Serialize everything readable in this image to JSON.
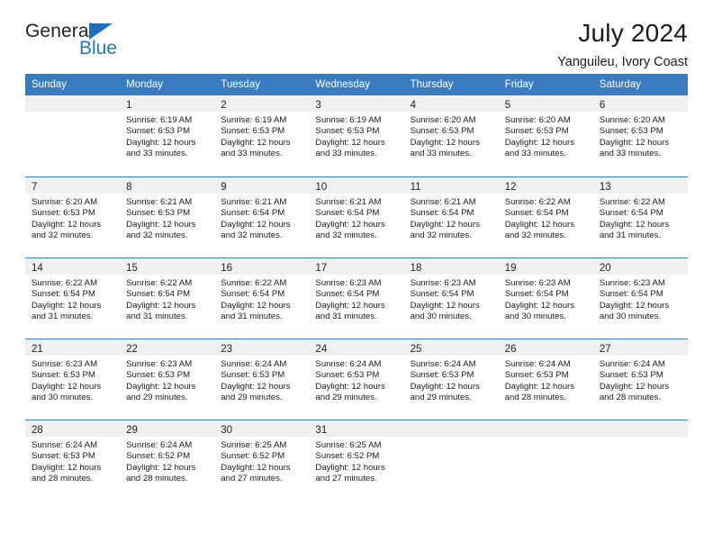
{
  "brand": {
    "name_top": "General",
    "name_bottom": "Blue",
    "triangle_color": "#1f6fc0",
    "blue_text_color": "#1f7ac4"
  },
  "header": {
    "title": "July 2024",
    "subtitle": "Yanguileu, Ivory Coast"
  },
  "theme": {
    "header_row_bg": "#3a7cc0",
    "daynum_band_bg": "#f0f0f0",
    "row_separator": "#3a7cc0"
  },
  "weekday_headers": [
    "Sunday",
    "Monday",
    "Tuesday",
    "Wednesday",
    "Thursday",
    "Friday",
    "Saturday"
  ],
  "weeks": [
    [
      {
        "day": "",
        "sunrise": "",
        "sunset": "",
        "daylight_line1": "",
        "daylight_line2": ""
      },
      {
        "day": "1",
        "sunrise": "Sunrise: 6:19 AM",
        "sunset": "Sunset: 6:53 PM",
        "daylight_line1": "Daylight: 12 hours",
        "daylight_line2": "and 33 minutes."
      },
      {
        "day": "2",
        "sunrise": "Sunrise: 6:19 AM",
        "sunset": "Sunset: 6:53 PM",
        "daylight_line1": "Daylight: 12 hours",
        "daylight_line2": "and 33 minutes."
      },
      {
        "day": "3",
        "sunrise": "Sunrise: 6:19 AM",
        "sunset": "Sunset: 6:53 PM",
        "daylight_line1": "Daylight: 12 hours",
        "daylight_line2": "and 33 minutes."
      },
      {
        "day": "4",
        "sunrise": "Sunrise: 6:20 AM",
        "sunset": "Sunset: 6:53 PM",
        "daylight_line1": "Daylight: 12 hours",
        "daylight_line2": "and 33 minutes."
      },
      {
        "day": "5",
        "sunrise": "Sunrise: 6:20 AM",
        "sunset": "Sunset: 6:53 PM",
        "daylight_line1": "Daylight: 12 hours",
        "daylight_line2": "and 33 minutes."
      },
      {
        "day": "6",
        "sunrise": "Sunrise: 6:20 AM",
        "sunset": "Sunset: 6:53 PM",
        "daylight_line1": "Daylight: 12 hours",
        "daylight_line2": "and 33 minutes."
      }
    ],
    [
      {
        "day": "7",
        "sunrise": "Sunrise: 6:20 AM",
        "sunset": "Sunset: 6:53 PM",
        "daylight_line1": "Daylight: 12 hours",
        "daylight_line2": "and 32 minutes."
      },
      {
        "day": "8",
        "sunrise": "Sunrise: 6:21 AM",
        "sunset": "Sunset: 6:53 PM",
        "daylight_line1": "Daylight: 12 hours",
        "daylight_line2": "and 32 minutes."
      },
      {
        "day": "9",
        "sunrise": "Sunrise: 6:21 AM",
        "sunset": "Sunset: 6:54 PM",
        "daylight_line1": "Daylight: 12 hours",
        "daylight_line2": "and 32 minutes."
      },
      {
        "day": "10",
        "sunrise": "Sunrise: 6:21 AM",
        "sunset": "Sunset: 6:54 PM",
        "daylight_line1": "Daylight: 12 hours",
        "daylight_line2": "and 32 minutes."
      },
      {
        "day": "11",
        "sunrise": "Sunrise: 6:21 AM",
        "sunset": "Sunset: 6:54 PM",
        "daylight_line1": "Daylight: 12 hours",
        "daylight_line2": "and 32 minutes."
      },
      {
        "day": "12",
        "sunrise": "Sunrise: 6:22 AM",
        "sunset": "Sunset: 6:54 PM",
        "daylight_line1": "Daylight: 12 hours",
        "daylight_line2": "and 32 minutes."
      },
      {
        "day": "13",
        "sunrise": "Sunrise: 6:22 AM",
        "sunset": "Sunset: 6:54 PM",
        "daylight_line1": "Daylight: 12 hours",
        "daylight_line2": "and 31 minutes."
      }
    ],
    [
      {
        "day": "14",
        "sunrise": "Sunrise: 6:22 AM",
        "sunset": "Sunset: 6:54 PM",
        "daylight_line1": "Daylight: 12 hours",
        "daylight_line2": "and 31 minutes."
      },
      {
        "day": "15",
        "sunrise": "Sunrise: 6:22 AM",
        "sunset": "Sunset: 6:54 PM",
        "daylight_line1": "Daylight: 12 hours",
        "daylight_line2": "and 31 minutes."
      },
      {
        "day": "16",
        "sunrise": "Sunrise: 6:22 AM",
        "sunset": "Sunset: 6:54 PM",
        "daylight_line1": "Daylight: 12 hours",
        "daylight_line2": "and 31 minutes."
      },
      {
        "day": "17",
        "sunrise": "Sunrise: 6:23 AM",
        "sunset": "Sunset: 6:54 PM",
        "daylight_line1": "Daylight: 12 hours",
        "daylight_line2": "and 31 minutes."
      },
      {
        "day": "18",
        "sunrise": "Sunrise: 6:23 AM",
        "sunset": "Sunset: 6:54 PM",
        "daylight_line1": "Daylight: 12 hours",
        "daylight_line2": "and 30 minutes."
      },
      {
        "day": "19",
        "sunrise": "Sunrise: 6:23 AM",
        "sunset": "Sunset: 6:54 PM",
        "daylight_line1": "Daylight: 12 hours",
        "daylight_line2": "and 30 minutes."
      },
      {
        "day": "20",
        "sunrise": "Sunrise: 6:23 AM",
        "sunset": "Sunset: 6:54 PM",
        "daylight_line1": "Daylight: 12 hours",
        "daylight_line2": "and 30 minutes."
      }
    ],
    [
      {
        "day": "21",
        "sunrise": "Sunrise: 6:23 AM",
        "sunset": "Sunset: 6:53 PM",
        "daylight_line1": "Daylight: 12 hours",
        "daylight_line2": "and 30 minutes."
      },
      {
        "day": "22",
        "sunrise": "Sunrise: 6:23 AM",
        "sunset": "Sunset: 6:53 PM",
        "daylight_line1": "Daylight: 12 hours",
        "daylight_line2": "and 29 minutes."
      },
      {
        "day": "23",
        "sunrise": "Sunrise: 6:24 AM",
        "sunset": "Sunset: 6:53 PM",
        "daylight_line1": "Daylight: 12 hours",
        "daylight_line2": "and 29 minutes."
      },
      {
        "day": "24",
        "sunrise": "Sunrise: 6:24 AM",
        "sunset": "Sunset: 6:53 PM",
        "daylight_line1": "Daylight: 12 hours",
        "daylight_line2": "and 29 minutes."
      },
      {
        "day": "25",
        "sunrise": "Sunrise: 6:24 AM",
        "sunset": "Sunset: 6:53 PM",
        "daylight_line1": "Daylight: 12 hours",
        "daylight_line2": "and 29 minutes."
      },
      {
        "day": "26",
        "sunrise": "Sunrise: 6:24 AM",
        "sunset": "Sunset: 6:53 PM",
        "daylight_line1": "Daylight: 12 hours",
        "daylight_line2": "and 28 minutes."
      },
      {
        "day": "27",
        "sunrise": "Sunrise: 6:24 AM",
        "sunset": "Sunset: 6:53 PM",
        "daylight_line1": "Daylight: 12 hours",
        "daylight_line2": "and 28 minutes."
      }
    ],
    [
      {
        "day": "28",
        "sunrise": "Sunrise: 6:24 AM",
        "sunset": "Sunset: 6:53 PM",
        "daylight_line1": "Daylight: 12 hours",
        "daylight_line2": "and 28 minutes."
      },
      {
        "day": "29",
        "sunrise": "Sunrise: 6:24 AM",
        "sunset": "Sunset: 6:52 PM",
        "daylight_line1": "Daylight: 12 hours",
        "daylight_line2": "and 28 minutes."
      },
      {
        "day": "30",
        "sunrise": "Sunrise: 6:25 AM",
        "sunset": "Sunset: 6:52 PM",
        "daylight_line1": "Daylight: 12 hours",
        "daylight_line2": "and 27 minutes."
      },
      {
        "day": "31",
        "sunrise": "Sunrise: 6:25 AM",
        "sunset": "Sunset: 6:52 PM",
        "daylight_line1": "Daylight: 12 hours",
        "daylight_line2": "and 27 minutes."
      },
      {
        "day": "",
        "sunrise": "",
        "sunset": "",
        "daylight_line1": "",
        "daylight_line2": ""
      },
      {
        "day": "",
        "sunrise": "",
        "sunset": "",
        "daylight_line1": "",
        "daylight_line2": ""
      },
      {
        "day": "",
        "sunrise": "",
        "sunset": "",
        "daylight_line1": "",
        "daylight_line2": ""
      }
    ]
  ]
}
